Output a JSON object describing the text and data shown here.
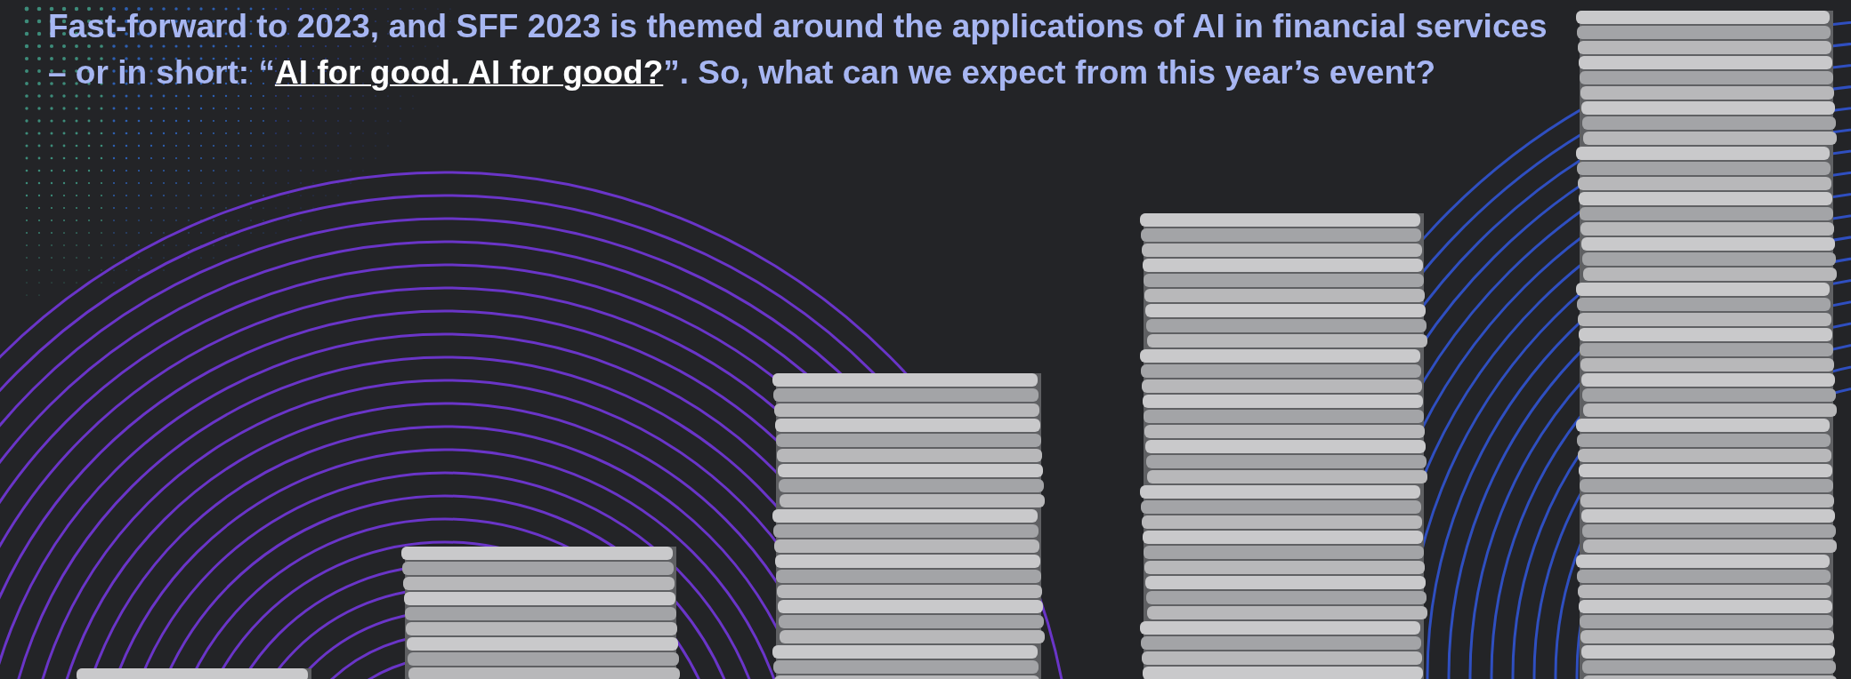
{
  "article": {
    "paragraph": {
      "text_before": "Fast-forward to 2023, and SFF 2023 is themed around the applications of AI in financial services – or in short: “",
      "link": "AI for good. AI for good?",
      "text_after": "”. So, what can we expect from this year’s event?"
    }
  }
}
